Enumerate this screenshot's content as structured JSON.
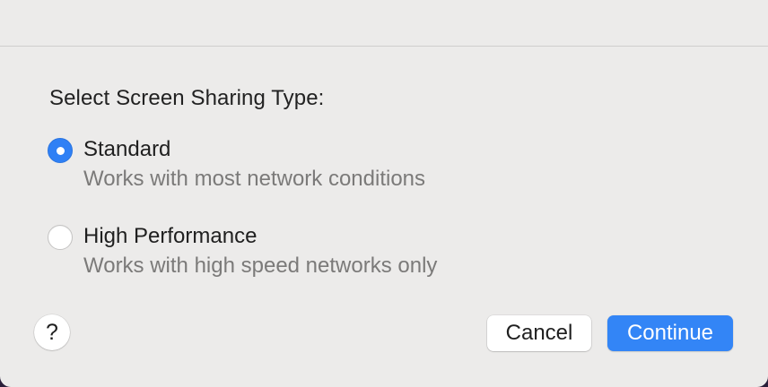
{
  "dialog": {
    "prompt": "Select Screen Sharing Type:",
    "options": [
      {
        "label": "Standard",
        "description": "Works with most network conditions",
        "selected": true
      },
      {
        "label": "High Performance",
        "description": "Works with high speed networks only",
        "selected": false
      }
    ],
    "help_label": "?",
    "cancel_label": "Cancel",
    "continue_label": "Continue"
  },
  "colors": {
    "accent": "#3385f6",
    "background": "#ecebea",
    "secondary_text": "#7b7a79"
  }
}
